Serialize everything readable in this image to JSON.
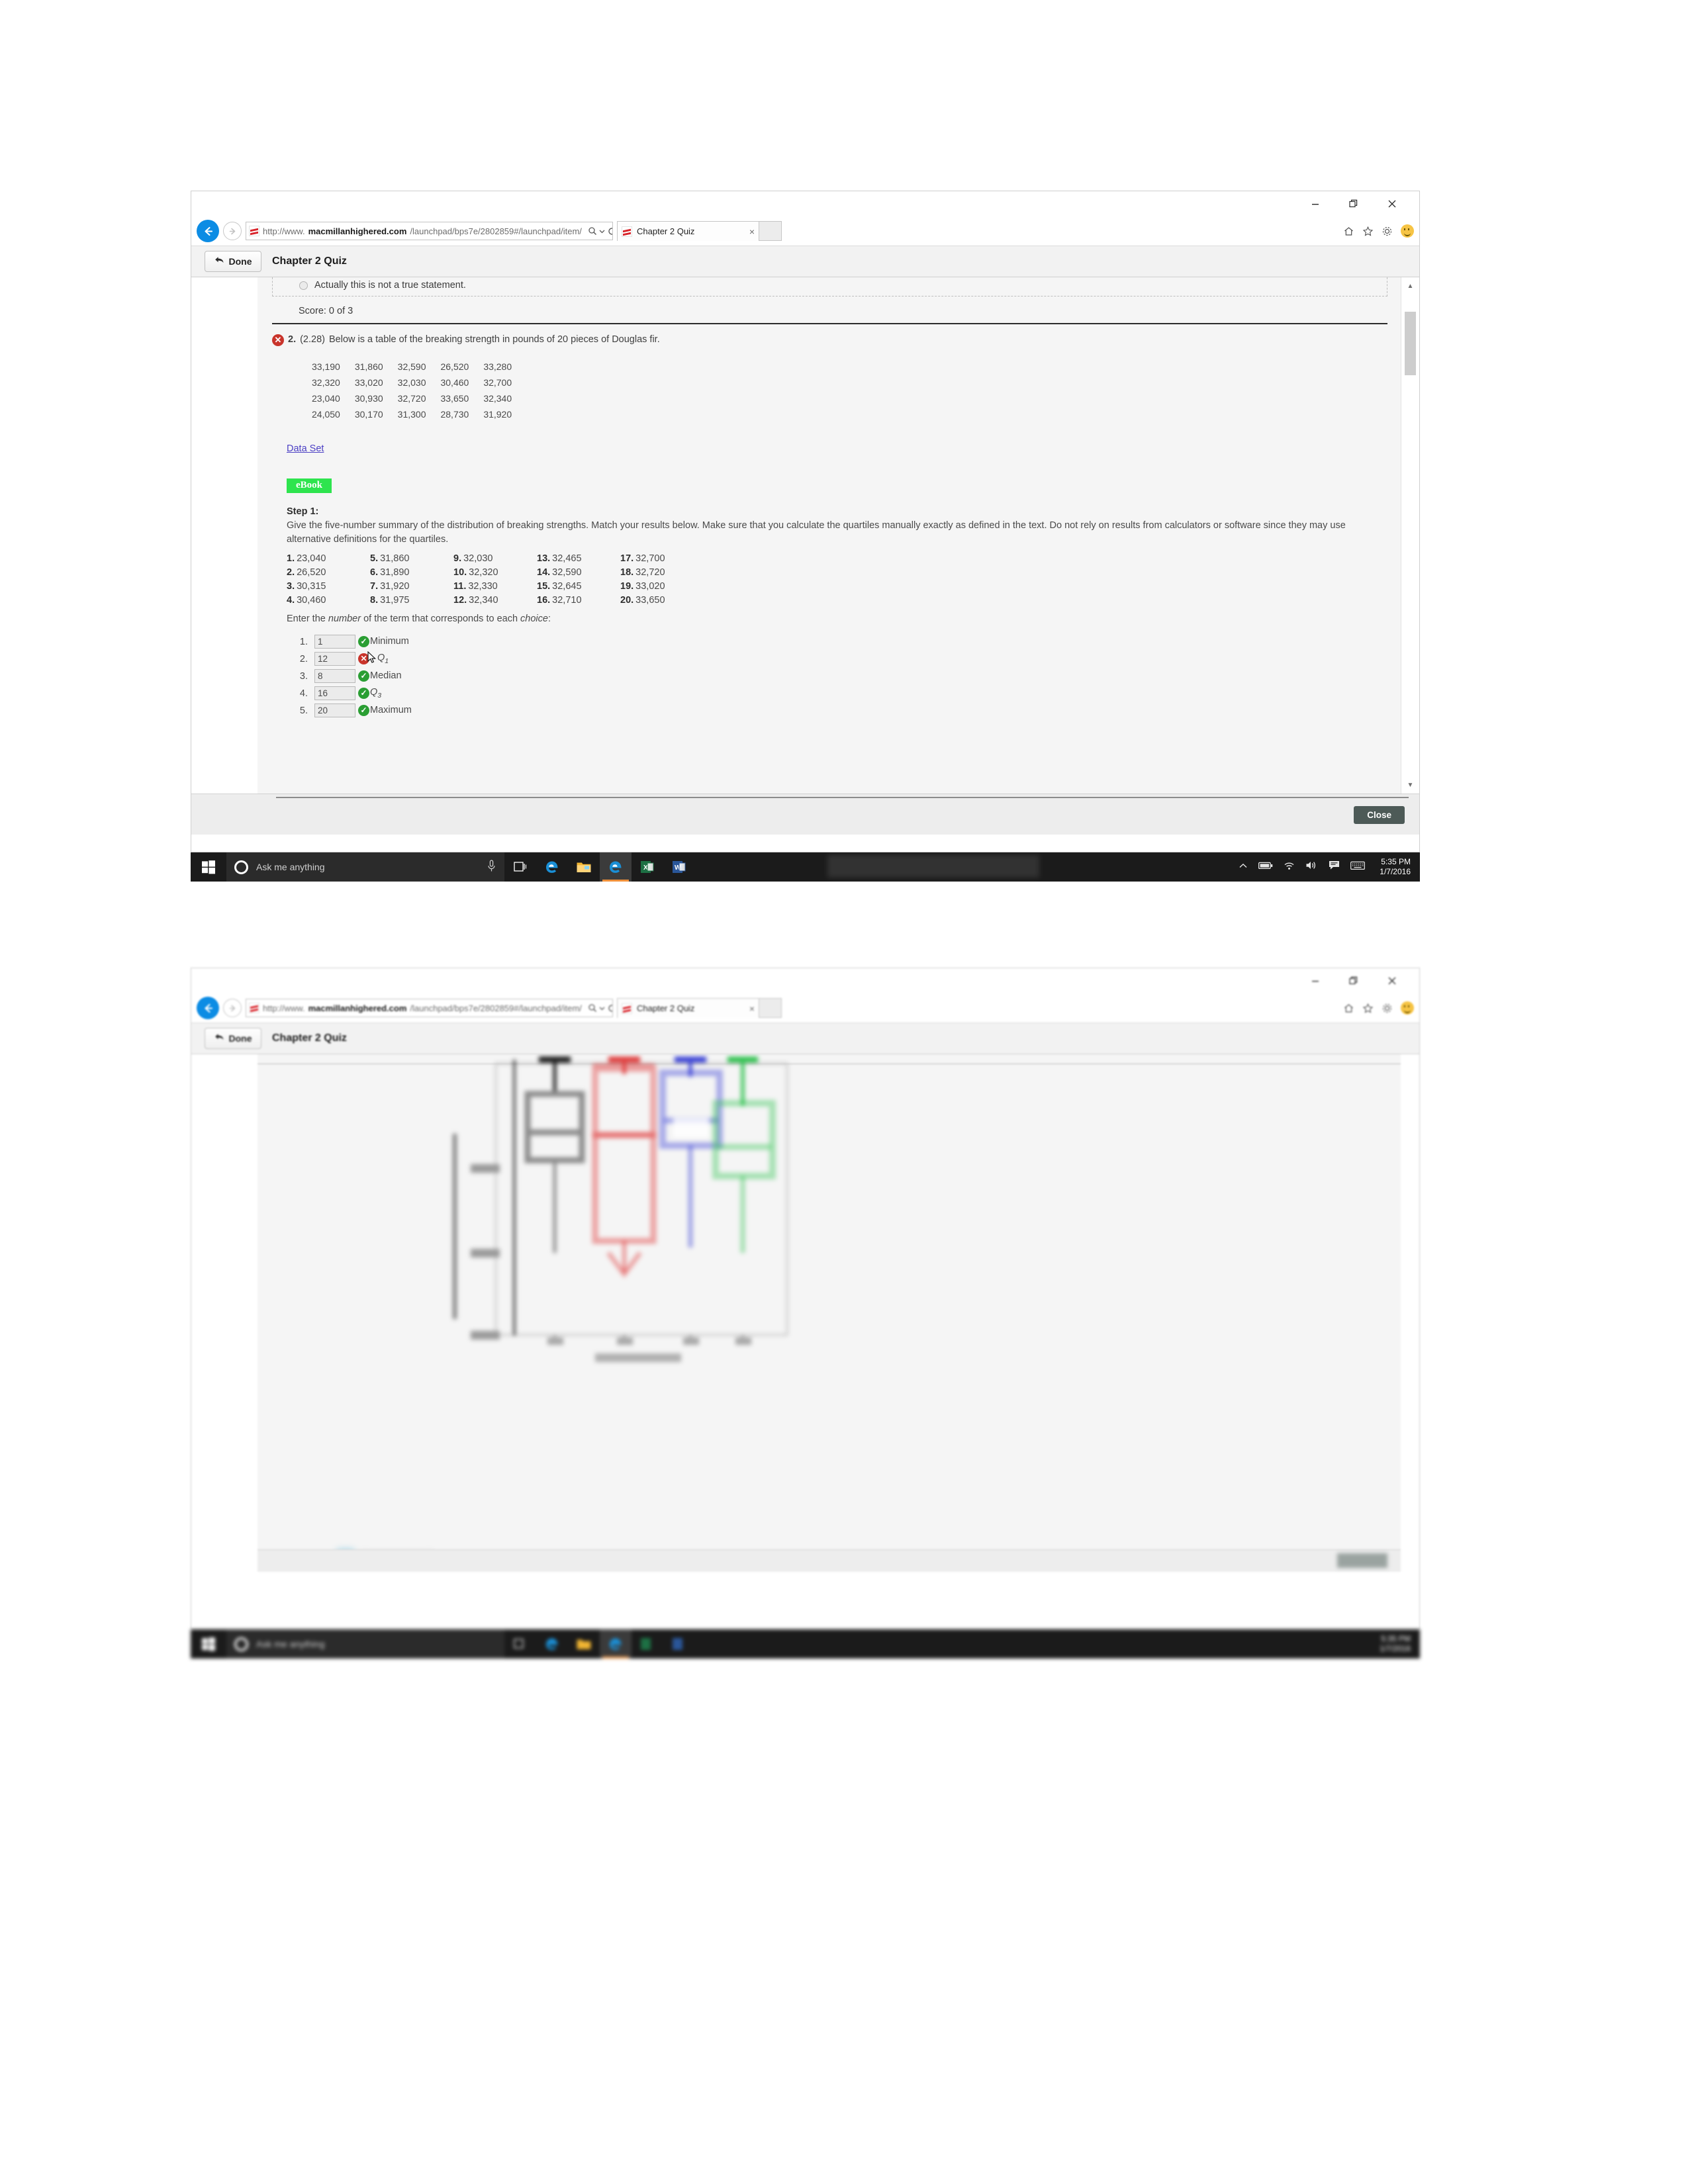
{
  "browser": {
    "url_prefix": "http://www.",
    "url_domain": "macmillanhighered.com",
    "url_suffix": "/launchpad/bps7e/2802859#/launchpad/item/",
    "tab_title": "Chapter 2 Quiz",
    "tab_close": "×",
    "favicon_name": "macmillan-favicon",
    "search_icon": "search-icon",
    "dropdown_icon": "chevron-down-icon",
    "refresh_icon": "refresh-icon",
    "home_icon": "home-icon",
    "favorites_icon": "star-icon",
    "settings_icon": "gear-icon",
    "smiley_icon": "smiley-icon",
    "minimize_label": "—",
    "restore_label": "❐",
    "close_label": "✕"
  },
  "app": {
    "done_label": "Done",
    "back_arrow_icon": "back-arrow-icon",
    "title": "Chapter 2 Quiz"
  },
  "quiz": {
    "prev_choice_text": "Actually this is not a true statement.",
    "score": "Score: 0 of 3",
    "question_number": "2.",
    "question_ref": "(2.28)",
    "question_text": "Below is a table of the breaking strength in pounds of 20 pieces of Douglas fir.",
    "wrong_badge": "✕",
    "data_table": [
      [
        "33,190",
        "31,860",
        "32,590",
        "26,520",
        "33,280"
      ],
      [
        "32,320",
        "33,020",
        "32,030",
        "30,460",
        "32,700"
      ],
      [
        "23,040",
        "30,930",
        "32,720",
        "33,650",
        "32,340"
      ],
      [
        "24,050",
        "30,170",
        "31,300",
        "28,730",
        "31,920"
      ]
    ],
    "data_set_link": "Data Set",
    "ebook_badge": "eBook",
    "step_title": "Step 1:",
    "step_text": "Give the five-number summary of the distribution of breaking strengths. Match your results below. Make sure that you calculate the quartiles manually exactly as defined in the text. Do not rely on results from calculators or software since they may use alternative definitions for the quartiles.",
    "options": [
      {
        "n": "1.",
        "v": "23,040"
      },
      {
        "n": "5.",
        "v": "31,860"
      },
      {
        "n": "9.",
        "v": "32,030"
      },
      {
        "n": "13.",
        "v": "32,465"
      },
      {
        "n": "17.",
        "v": "32,700"
      },
      {
        "n": "2.",
        "v": "26,520"
      },
      {
        "n": "6.",
        "v": "31,890"
      },
      {
        "n": "10.",
        "v": "32,320"
      },
      {
        "n": "14.",
        "v": "32,590"
      },
      {
        "n": "18.",
        "v": "32,720"
      },
      {
        "n": "3.",
        "v": "30,315"
      },
      {
        "n": "7.",
        "v": "31,920"
      },
      {
        "n": "11.",
        "v": "32,330"
      },
      {
        "n": "15.",
        "v": "32,645"
      },
      {
        "n": "19.",
        "v": "33,020"
      },
      {
        "n": "4.",
        "v": "30,460"
      },
      {
        "n": "8.",
        "v": "31,975"
      },
      {
        "n": "12.",
        "v": "32,340"
      },
      {
        "n": "16.",
        "v": "32,710"
      },
      {
        "n": "20.",
        "v": "33,650"
      }
    ],
    "enter_prefix": "Enter the ",
    "enter_em1": "number",
    "enter_mid": " of the term that corresponds to each ",
    "enter_em2": "choice",
    "enter_suffix": ":",
    "answers": [
      {
        "value": "1",
        "status": "correct",
        "mark": "✓",
        "label": "Minimum",
        "sub": "",
        "italic": false,
        "cursor": false
      },
      {
        "value": "12",
        "status": "incorrect",
        "mark": "✕",
        "label": "Q",
        "sub": "1",
        "italic": true,
        "cursor": true
      },
      {
        "value": "8",
        "status": "correct",
        "mark": "✓",
        "label": "Median",
        "sub": "",
        "italic": false,
        "cursor": false
      },
      {
        "value": "16",
        "status": "correct",
        "mark": "✓",
        "label": "Q",
        "sub": "3",
        "italic": true,
        "cursor": false
      },
      {
        "value": "20",
        "status": "correct",
        "mark": "✓",
        "label": "Maximum",
        "sub": "",
        "italic": false,
        "cursor": false
      }
    ],
    "close_button": "Close"
  },
  "colors": {
    "correct": "#2a9e33",
    "incorrect": "#c9342b",
    "ebook_green": "#2ee44e",
    "link_purple": "#4b3fc4",
    "accent_blue": "#0c8ce4",
    "close_btn": "#4d5a57"
  },
  "taskbar": {
    "start_icon": "windows-start-icon",
    "cortana_placeholder": "Ask me anything",
    "cortana_icon": "cortana-circle-icon",
    "mic_icon": "microphone-icon",
    "taskview_icon": "task-view-icon",
    "apps": [
      "edge-icon",
      "file-explorer-icon",
      "edge-active-icon",
      "excel-icon",
      "word-icon"
    ],
    "tray": [
      "show-hidden-icons-chevron",
      "battery-icon",
      "wifi-icon",
      "volume-icon",
      "action-center-icon",
      "keyboard-icon"
    ],
    "time": "5:35 PM",
    "date": "1/7/2016"
  },
  "chart_data": {
    "type": "boxplot",
    "title": "",
    "xlabel": "",
    "ylabel": "",
    "note": "Blurred/out-of-focus side-by-side boxplot comparison figure in the second browser window",
    "categories": [
      "1",
      "2",
      "3",
      "4"
    ],
    "series_colors": [
      "#3a3a3a",
      "#e03b3b",
      "#3b43d6",
      "#2fc24f"
    ],
    "boxes": [
      {
        "name": "1",
        "color": "#3a3a3a",
        "whisker_low": 18,
        "q1": 56,
        "median": 66,
        "q3": 78,
        "whisker_high": 95
      },
      {
        "name": "2",
        "color": "#e03b3b",
        "whisker_low": 28,
        "q1": 40,
        "median": 72,
        "q3": 84,
        "whisker_high": 96
      },
      {
        "name": "3",
        "color": "#3b43d6",
        "whisker_low": 44,
        "q1": 60,
        "median": 70,
        "q3": 84,
        "whisker_high": 96
      },
      {
        "name": "4",
        "color": "#2fc24f",
        "whisker_low": 42,
        "q1": 52,
        "median": 62,
        "q3": 74,
        "whisker_high": 94
      }
    ],
    "ylim": [
      0,
      100
    ],
    "grid": false,
    "legend_position": "bottom-left"
  }
}
